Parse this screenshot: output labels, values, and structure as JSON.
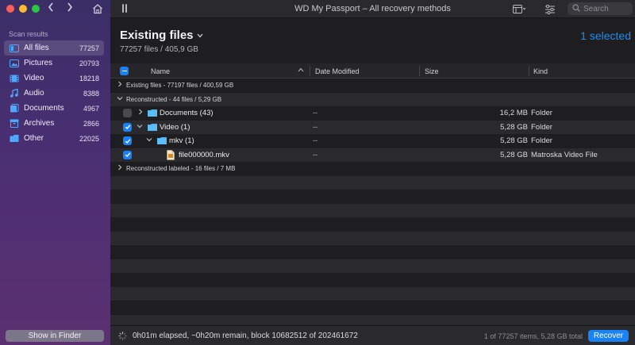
{
  "window": {
    "title": "WD My Passport – All recovery methods",
    "controls": [
      "close",
      "minimize",
      "maximize"
    ]
  },
  "toolbar": {
    "back_icon": "chevron-left-icon",
    "forward_icon": "chevron-right-icon",
    "home_icon": "home-icon",
    "sidebar_toggle_icon": "sidebar-toggle-icon",
    "view_icon": "view-options-icon",
    "filter_icon": "sliders-icon",
    "search_placeholder": "Search"
  },
  "sidebar": {
    "section_label": "Scan results",
    "items": [
      {
        "label": "All files",
        "count": "77257",
        "icon": "all-files-icon",
        "active": true
      },
      {
        "label": "Pictures",
        "count": "20793",
        "icon": "pictures-icon",
        "active": false
      },
      {
        "label": "Video",
        "count": "18218",
        "icon": "video-icon",
        "active": false
      },
      {
        "label": "Audio",
        "count": "8388",
        "icon": "audio-icon",
        "active": false
      },
      {
        "label": "Documents",
        "count": "4967",
        "icon": "documents-icon",
        "active": false
      },
      {
        "label": "Archives",
        "count": "2866",
        "icon": "archives-icon",
        "active": false
      },
      {
        "label": "Other",
        "count": "22025",
        "icon": "other-icon",
        "active": false
      }
    ],
    "finder_button": "Show in Finder"
  },
  "header": {
    "title": "Existing files",
    "subtitle": "77257 files / 405,9 GB",
    "selected": "1 selected"
  },
  "table": {
    "columns": {
      "name": "Name",
      "date": "Date Modified",
      "size": "Size",
      "kind": "Kind"
    },
    "groups": {
      "existing": "Existing files - 77197 files / 400,59 GB",
      "reconstructed": "Reconstructed - 44 files / 5,29 GB",
      "reconstructed_labeled": "Reconstructed labeled - 16 files / 7 MB"
    },
    "rows": [
      {
        "name": "Documents (43)",
        "date": "--",
        "size": "16,2 MB",
        "kind": "Folder",
        "checked": false
      },
      {
        "name": "Video (1)",
        "date": "--",
        "size": "5,28 GB",
        "kind": "Folder",
        "checked": true
      },
      {
        "name": "mkv (1)",
        "date": "--",
        "size": "5,28 GB",
        "kind": "Folder",
        "checked": true
      },
      {
        "name": "file000000.mkv",
        "date": "--",
        "size": "5,28 GB",
        "kind": "Matroska Video File",
        "checked": true
      }
    ]
  },
  "status": {
    "progress_text": "0h01m elapsed, ~0h20m remain, block 10682512 of 202461672",
    "items_text": "1 of 77257 items, 5,28 GB total",
    "recover_button": "Recover"
  },
  "colors": {
    "accent": "#1a82f7",
    "sidebar_top": "#3a2e66",
    "sidebar_bottom": "#5b3070",
    "folder": "#4fb3f6"
  }
}
